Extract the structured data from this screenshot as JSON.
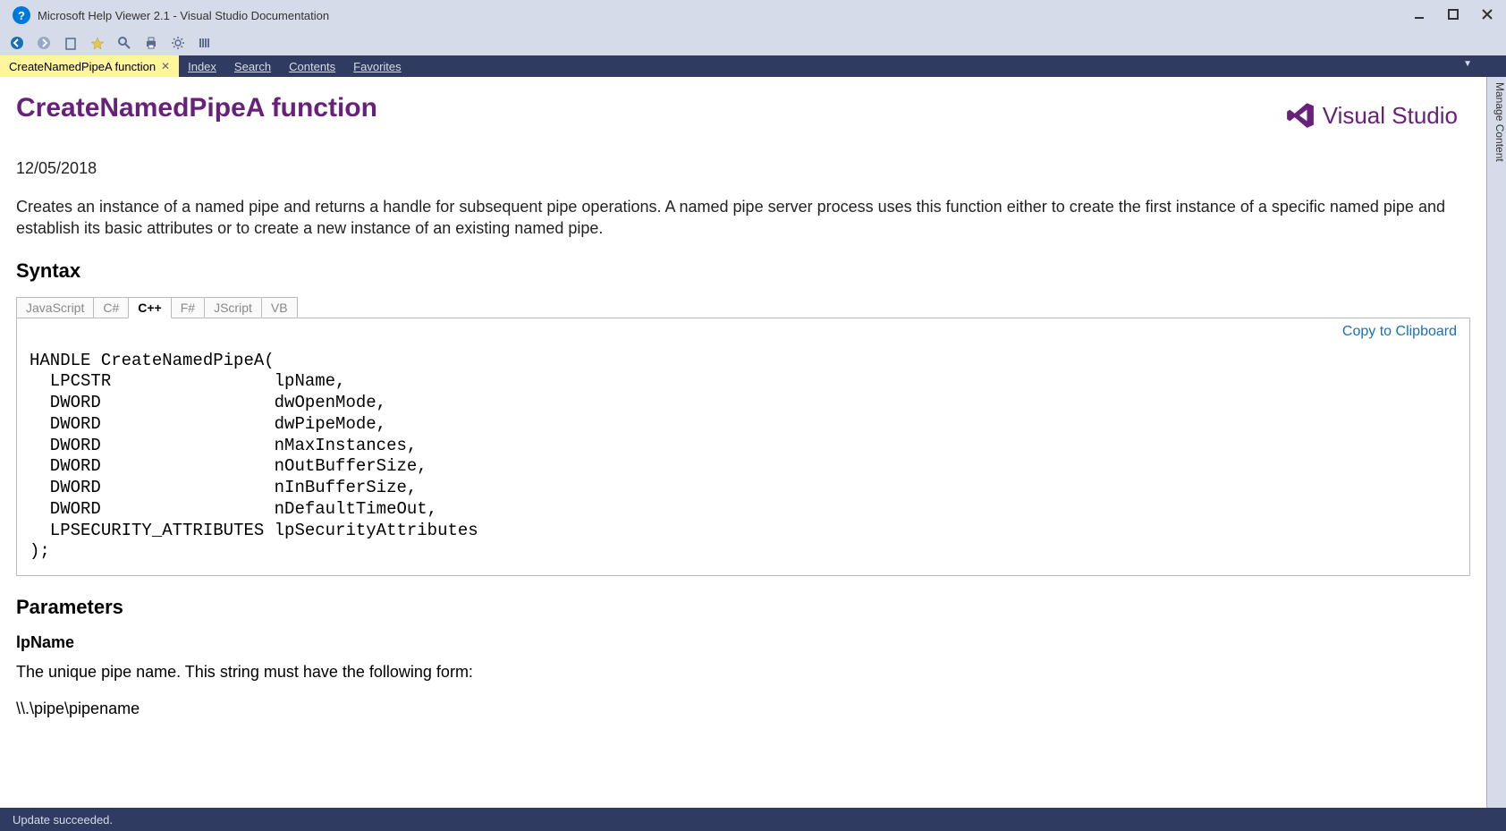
{
  "window": {
    "title": "Microsoft Help Viewer 2.1 - Visual Studio Documentation"
  },
  "tabs": {
    "active": "CreateNamedPipeA function",
    "items": [
      "Index",
      "Search",
      "Contents",
      "Favorites"
    ]
  },
  "side_rail": "Manage Content",
  "page": {
    "title": "CreateNamedPipeA function",
    "brand": "Visual Studio",
    "date": "12/05/2018",
    "description": "Creates an instance of a named pipe and returns a handle for subsequent pipe operations. A named pipe server process uses this function either to create the first instance of a specific named pipe and establish its basic attributes or to create a new instance of an existing named pipe.",
    "syntax_heading": "Syntax",
    "lang_tabs": [
      "JavaScript",
      "C#",
      "C++",
      "F#",
      "JScript",
      "VB"
    ],
    "lang_active": "C++",
    "copy_label": "Copy to Clipboard",
    "code": "HANDLE CreateNamedPipeA(\n  LPCSTR                lpName,\n  DWORD                 dwOpenMode,\n  DWORD                 dwPipeMode,\n  DWORD                 nMaxInstances,\n  DWORD                 nOutBufferSize,\n  DWORD                 nInBufferSize,\n  DWORD                 nDefaultTimeOut,\n  LPSECURITY_ATTRIBUTES lpSecurityAttributes\n);",
    "parameters_heading": "Parameters",
    "param1_name": "lpName",
    "param1_desc": "The unique pipe name. This string must have the following form:",
    "param1_form": "\\\\.\\pipe\\pipename"
  },
  "status": "Update succeeded."
}
